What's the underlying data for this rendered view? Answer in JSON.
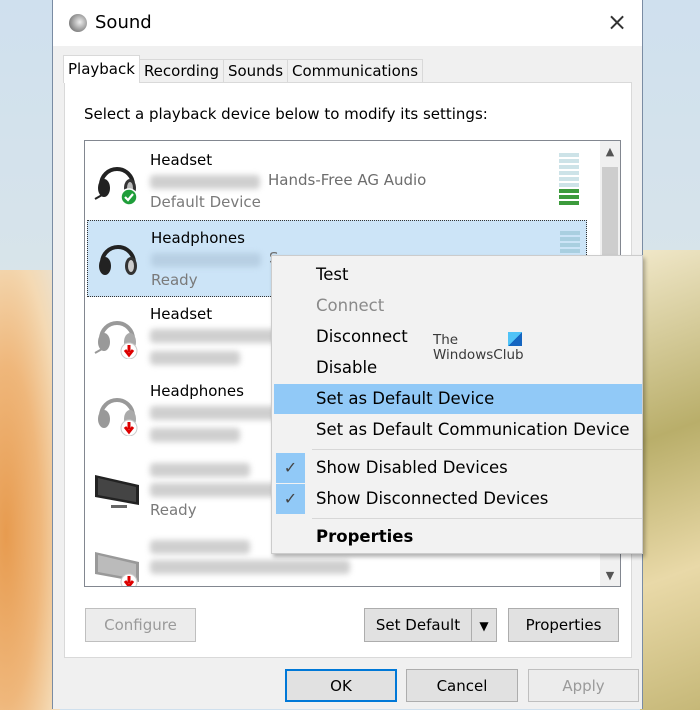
{
  "window": {
    "title": "Sound",
    "close_icon": "×"
  },
  "tabs": [
    "Playback",
    "Recording",
    "Sounds",
    "Communications"
  ],
  "instruction": "Select a playback device below to modify its settings:",
  "devices": [
    {
      "name": "Headset",
      "desc": "Hands-Free AG Audio",
      "status": "Default Device",
      "icon": "headset-icon",
      "badge": "green-check"
    },
    {
      "name": "Headphones",
      "desc": "S",
      "status": "Ready",
      "icon": "headphones-icon",
      "selected": true
    },
    {
      "name": "Headset",
      "status": "",
      "icon": "headset-icon",
      "badge": "red-down-arrow"
    },
    {
      "name": "Headphones",
      "status": "",
      "icon": "headphones-icon",
      "badge": "red-down-arrow"
    },
    {
      "name": "",
      "status": "Ready",
      "icon": "monitor-icon"
    },
    {
      "name": "",
      "status": "",
      "icon": "monitor-icon",
      "badge": "red-down-arrow"
    }
  ],
  "buttons": {
    "configure": "Configure",
    "set_default": "Set Default",
    "properties": "Properties",
    "ok": "OK",
    "cancel": "Cancel",
    "apply": "Apply"
  },
  "context_menu": {
    "items": [
      "Test",
      "Connect",
      "Disconnect",
      "Disable",
      "Set as Default Device",
      "Set as Default Communication Device",
      "Show Disabled Devices",
      "Show Disconnected Devices",
      "Properties"
    ],
    "check": "✓"
  },
  "watermark": {
    "line1": "The",
    "line2": "WindowsClub"
  }
}
